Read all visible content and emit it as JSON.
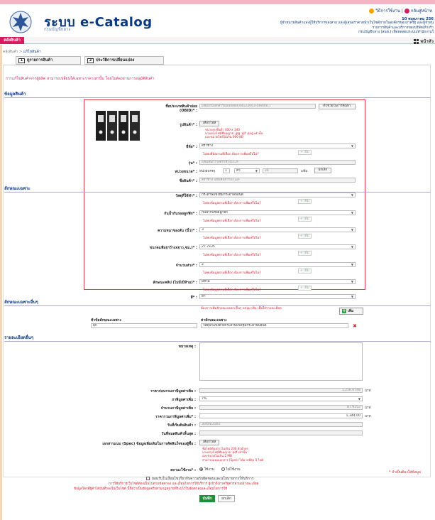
{
  "header": {
    "brand": "ระบบ e-Catalog",
    "brand_sub": "กรมบัญชีกลาง",
    "link1": "วิธีการใช้งาน",
    "sep": "|",
    "link2": "กลับสู่หน้าห",
    "date": "10 พฤษภาคม 256",
    "info1": "ผู้จำหน่ายสินค้าและผู้ให้บริการของสาย และผู้เสนอราคาหน้าเว็บไซต์ภายในองค์กรของภาครัฐ และผู้จำหน",
    "info2": "รายการสินค้าและบริการของบริษัท/ห้างร้า",
    "info3": "กรมบัญชีกลาง (สนข.) เพื่อทดสอบระบบ/สำนักงานใ"
  },
  "nav": {
    "main_btn": "คลังสินค้า",
    "home": "หน้าหัว"
  },
  "breadcrumb": {
    "root": "คลังสินค้า >",
    "current": "แก้ไขสินค้า"
  },
  "tabs": [
    {
      "n": "1",
      "label": "ดูรายการสินค้า"
    },
    {
      "n": "2",
      "label": "ประวัติการเปลี่ยนแปลง"
    }
  ],
  "notice": "การแก้ไขสินค้าจากผู้ผลิต สามารถเปลี่ยนได้เฉพาะราคาเท่านั้น โดยไม่ต้องผ่านการอนุมัติสินค้า",
  "sections": {
    "product": "ข้อมูลสินค้า",
    "spec": "ลักษณะเฉพาะ",
    "extra_spec": "ลักษณะเฉพาะอื่นๆ",
    "other": "รายละเอียดอื่นๆ"
  },
  "product": {
    "obid_label": "ชื่อประเภทสินค้าย่อย (OBID)* :",
    "obid_value": "แฟ้มเก็บเอกสารแบบกล่อง(44122003-000001)",
    "obid_btn": "ตัวช่วยในการค้นหา",
    "image_label": "รูปสินค้า* :",
    "image_btn": "เลือกไฟล์",
    "image_hint1": "ขนาดรูปขั้นต่ำ 400 x 340",
    "image_hint2": "นามสกุลไฟล์ที่อนุญาต .jpg .gif .png เท่านั้น",
    "image_hint3": "และขนาดไฟล์ไม่เกิน 600 KB",
    "brand_label": "ยี่ห้อ* :",
    "brand_value": "ตราช้าง",
    "brand_warn": "ไม่พบยี่ห้อตามที่เลือก ต้องการเพิ่มหรือไม่?",
    "add": "+ เพิ่ม",
    "model_label": "รุ่น* :",
    "model_value": "แฟ้มสันกว้างตราช้าง112F",
    "unit_label": "หน่วยขนาด* :",
    "unit_prefix": "หน่วยบรรจุ",
    "unit_qty": "1",
    "unit_name": "ตัว",
    "unit_count": "24",
    "unit_suffix": "แฟ้ม",
    "unit_btn": "ยกเลิก",
    "name_label": "ชื่อสินค้า* :",
    "name_value": "ตราช้าง แฟ้มสันกว้าง112F"
  },
  "specs": [
    {
      "label": "วัสดุที่ใช้ทำ* :",
      "value": "กระดาษแข็งหุ้มกระดาษปอนด์"
    },
    {
      "label": "กันน้ำกันรอยลูกฟิก* :",
      "value": "กันน้ำกันรอยลูกฟิก"
    },
    {
      "label": "ความหนาของสัน (นิ้ว)* :",
      "value": "3"
    },
    {
      "label": "ขนาดแฟ้ม(กว้างxยาว,ซม.)* :",
      "value": "27.7x35"
    },
    {
      "label": "จำนวนห่วง* :",
      "value": "2"
    },
    {
      "label": "ลักษณะคลิป (ไม่มี/มีห้าม)* :",
      "value": "มีห้าม"
    },
    {
      "label": "สี* :",
      "value": "ดำ"
    }
  ],
  "spec_warn": "ไม่พบข้อมูลตามที่เลือก ต้องการเพิ่มหรือไม่?",
  "extra": {
    "note": "ต้องการเพิ่มลักษณะเฉพาะอื่นๆ กดปุ่ม เพิ่ม เพื่อใส่รายละเอียด",
    "add_btn": "เพิ่ม",
    "col1": "หัวข้อลักษณะเฉพาะ",
    "col2": "ค่าลักษณะเฉพาะ",
    "v1": "ผุก",
    "v2": "วัสดุปกแข็งด้วยกระดาษแข็งหุ้มกระดาษปอนด์",
    "x": "✖"
  },
  "other": {
    "note_label": "หมายเหตุ :",
    "price_ex_label": "ราคาก่อนรวมภาษีมูลค่าเพิ่ม :",
    "price_ex_value": "1,256.0748",
    "baht": "บาท",
    "vat_label": "ภาษีมูลค่าเพิ่ม :",
    "vat_value": "7%",
    "vat_amount_label": "จำนวนภาษีมูลค่าเพิ่ม :",
    "vat_amount_value": "87.9252",
    "price_in_label": "ราคารวมภาษีมูลค่าเพิ่ม* :",
    "price_in_value": "1,344.00",
    "start_label": "วันที่เริ่มต้นสินค้า :",
    "start_value": "30/04/2561",
    "end_label": "วันที่หมดสินค้าสิ้นสุด :",
    "spec_doc_label": "เอกสารแนบ (Spec) ข้อมูลเพิ่มเติมในการตัดสินใจของผู้ซื้อ :",
    "spec_doc_btn": "เลือกไฟล์",
    "spec_hint1": "ชื่อไฟล์ต้องยาวไม่เกิน 200 ตัวอักษร",
    "spec_hint2": "นามสกุลไฟล์ที่อนุญาต .pdf เท่านั้น",
    "spec_hint3": "และขนาดไม่เกิน 2 MB",
    "spec_hint4": "สามารถแนบเอกสาร (Spec) ได้มากที่สุด 5 ไฟล์",
    "status_label": "สถานะใช้งาน* :",
    "status_on": "ใช้งาน",
    "status_off": "ไม่ใช้งาน",
    "required": "* จำเป็นต้องใส่ข้อมูล"
  },
  "footer": {
    "accept": "ยอมรับในเงื่อนไขเกี่ยวกับความรับผิดชอบและนโยบายการให้บริการ",
    "line1": "การใช้บริการเว็บไซต์ต้องเป็นไปตามข้อตกลง และเงื่อนไขการให้บริการ ผู้เข้าถึงภาครัฐควรอ่านอย่างละเอียด",
    "line2": "ข้อมูลใดๆที่ผู้ค้าได้บันทึกลงในเว็บไซต์ นี้ถือว่าเป็นข้อมูลจริงตามกฎหมายที่ระบุไว้ในข้อตกลงและเงื่อนไขการใช้",
    "submit": "บันทึก",
    "cancel": "ยกเลิก"
  },
  "colors": {
    "accent": "#d81b60",
    "brand": "#0b3a82",
    "ok": "#1f8f3a",
    "error": "#d8202f"
  }
}
